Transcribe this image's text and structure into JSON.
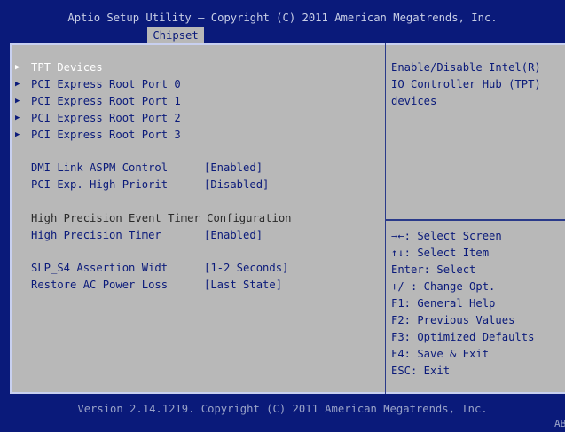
{
  "header": {
    "title": "Aptio Setup Utility – Copyright (C) 2011 American Megatrends, Inc.",
    "active_tab": "Chipset"
  },
  "menu": {
    "submenus": [
      {
        "label": "TPT Devices",
        "selected": true
      },
      {
        "label": "PCI Express Root Port 0",
        "selected": false
      },
      {
        "label": "PCI Express Root Port 1",
        "selected": false
      },
      {
        "label": "PCI Express Root Port 2",
        "selected": false
      },
      {
        "label": "PCI Express Root Port 3",
        "selected": false
      }
    ],
    "settings1": [
      {
        "label": "DMI Link ASPM Control",
        "value": "[Enabled]"
      },
      {
        "label": "PCI-Exp. High Priorit",
        "value": "[Disabled]"
      }
    ],
    "section_heading": "High Precision Event Timer Configuration",
    "settings2": [
      {
        "label": "High Precision Timer",
        "value": "[Enabled]"
      }
    ],
    "settings3": [
      {
        "label": "SLP_S4 Assertion Widt",
        "value": "[1-2 Seconds]"
      },
      {
        "label": "Restore AC Power Loss",
        "value": "[Last State]"
      }
    ]
  },
  "help": {
    "lines": [
      "Enable/Disable Intel(R)",
      "IO Controller Hub (TPT)",
      "devices"
    ]
  },
  "keys": [
    "→←: Select Screen",
    "↑↓: Select Item",
    "Enter: Select",
    "+/-: Change Opt.",
    "F1: General Help",
    "F2: Previous Values",
    "F3: Optimized Defaults",
    "F4: Save & Exit",
    "ESC: Exit"
  ],
  "footer": {
    "version": "Version 2.14.1219. Copyright (C) 2011 American Megatrends, Inc.",
    "corner": "AB"
  },
  "colors": {
    "background": "#0a1a7a",
    "panel": "#b8b8b8",
    "text": "#0a1a7a",
    "selected_text": "#ffffff"
  }
}
